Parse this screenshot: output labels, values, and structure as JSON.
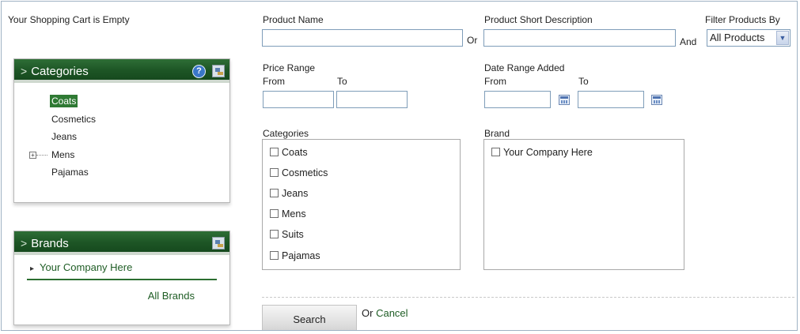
{
  "cart": {
    "status": "Your Shopping Cart is Empty"
  },
  "categories_panel": {
    "title": "Categories",
    "items": [
      {
        "label": "Coats",
        "selected": true
      },
      {
        "label": "Cosmetics"
      },
      {
        "label": "Jeans"
      },
      {
        "label": "Mens",
        "expandable": true
      },
      {
        "label": "Pajamas"
      }
    ]
  },
  "brands_panel": {
    "title": "Brands",
    "items": [
      {
        "label": "Your Company Here"
      }
    ],
    "all_link": "All Brands"
  },
  "search_form": {
    "product_name_label": "Product Name",
    "product_name_value": "",
    "or_label": "Or",
    "short_desc_label": "Product Short Description",
    "short_desc_value": "",
    "and_label": "And",
    "filter_label": "Filter Products By",
    "filter_value": "All Products",
    "price_range_label": "Price Range",
    "price_from_label": "From",
    "price_to_label": "To",
    "date_range_label": "Date Range Added",
    "date_from_label": "From",
    "date_to_label": "To",
    "categories_label": "Categories",
    "category_options": [
      "Coats",
      "Cosmetics",
      "Jeans",
      "Mens",
      "Suits",
      "Pajamas"
    ],
    "brand_label": "Brand",
    "brand_options": [
      "Your Company Here"
    ],
    "search_button": "Search",
    "or_cancel_prefix": "Or",
    "cancel_link": "Cancel"
  },
  "icons": {
    "chevron": "chevron-right-icon",
    "help": "help-icon",
    "edit": "edit-panel-icon",
    "calendar": "calendar-icon",
    "dropdown": "dropdown-arrow-icon",
    "expander": "tree-expand-icon",
    "bullet": "bullet-arrow-icon"
  },
  "colors": {
    "panel_header": "#1d5525",
    "link_green": "#1f5d25",
    "link_blue": "#1d4f8c",
    "selected_bg": "#2f7a34",
    "input_border": "#7f9db9"
  }
}
